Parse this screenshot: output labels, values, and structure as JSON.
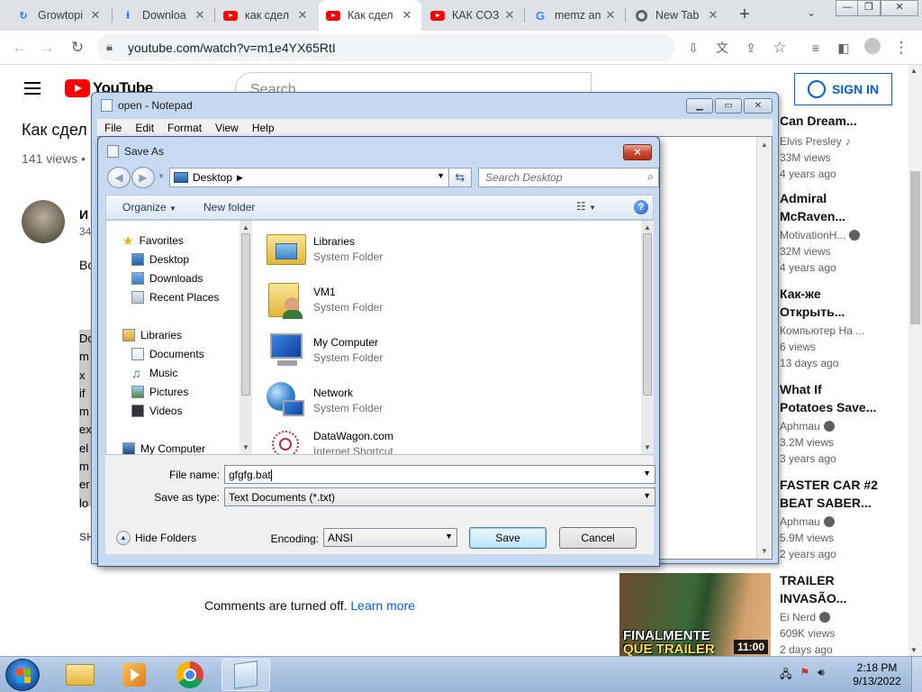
{
  "browser": {
    "tabs": [
      {
        "title": "Growtopi",
        "icon": "growtopia-favicon"
      },
      {
        "title": "Downloa",
        "icon": "download-favicon"
      },
      {
        "title": "как сдел",
        "icon": "youtube-favicon"
      },
      {
        "title": "Как сдел",
        "icon": "youtube-favicon",
        "active": true
      },
      {
        "title": "КАК СОЗ",
        "icon": "youtube-favicon"
      },
      {
        "title": "memz an",
        "icon": "google-favicon"
      },
      {
        "title": "New Tab",
        "icon": "chrome-favicon"
      }
    ],
    "close_glyph": "✕",
    "new_tab_glyph": "+",
    "tab_search_glyph": "⌄",
    "url": "youtube.com/watch?v=m1e4YX65RtI"
  },
  "youtube": {
    "logo_text": "YouTube",
    "search_placeholder": "Search",
    "sign_in_label": "SIGN IN",
    "video_title": "Как сдел",
    "views": "141 views •",
    "channel_initial": "И",
    "channel_sub": "34",
    "desc_lead": "Во",
    "desc_lines": [
      "Do",
      "m",
      "x",
      "if",
      "m",
      "ex",
      "el",
      "m",
      "er",
      "lo"
    ],
    "share_fragment": "SH",
    "comments_off": "Comments are turned off.",
    "learn_more": "Learn more",
    "recommendations": [
      {
        "title": "Can Dream...",
        "channel": "Elvis Presley",
        "badge": "♪",
        "views": "33M views",
        "age": "4 years ago"
      },
      {
        "title": "Admiral McRaven...",
        "title2": "McRaven...",
        "channel": "MotivationH...",
        "badge": "verified",
        "views": "32M views",
        "age": "4 years ago"
      },
      {
        "title": "Как-же",
        "title2": "Открыть...",
        "channel": "Компьютер На ...",
        "badge": "",
        "views": "6 views",
        "age": "13 days ago"
      },
      {
        "title": "What If",
        "title2": "Potatoes Save...",
        "channel": "Aphmau",
        "badge": "verified",
        "views": "3.2M views",
        "age": "3 years ago"
      },
      {
        "title": "FASTER CAR #2",
        "title2": "BEAT SABER...",
        "channel": "Aphmau",
        "badge": "verified",
        "views": "5.9M views",
        "age": "2 years ago"
      },
      {
        "title": "TRAILER",
        "title2": "INVASÃO...",
        "channel": "Ei Nerd",
        "badge": "verified",
        "views": "609K views",
        "age": "2 days ago"
      }
    ],
    "thumb_line1": "FINALMENTE",
    "thumb_line2": "QUE TRAILER",
    "thumb_duration": "11:00"
  },
  "notepad": {
    "title": "open - Notepad",
    "menu": [
      "File",
      "Edit",
      "Format",
      "View",
      "Help"
    ]
  },
  "save_as": {
    "title": "Save As",
    "address": "Desktop",
    "search_placeholder": "Search Desktop",
    "organize": "Organize",
    "new_folder": "New folder",
    "nav": {
      "favorites": "Favorites",
      "desktop": "Desktop",
      "downloads": "Downloads",
      "recent_places": "Recent Places",
      "libraries": "Libraries",
      "documents": "Documents",
      "music": "Music",
      "pictures": "Pictures",
      "videos": "Videos",
      "my_computer": "My Computer"
    },
    "files": [
      {
        "name": "Libraries",
        "type": "System Folder",
        "icon": "libraries-folder-icon"
      },
      {
        "name": "VM1",
        "type": "System Folder",
        "icon": "user-folder-icon"
      },
      {
        "name": "My Computer",
        "type": "System Folder",
        "icon": "computer-icon"
      },
      {
        "name": "Network",
        "type": "System Folder",
        "icon": "network-icon"
      },
      {
        "name": "DataWagon.com",
        "type": "Internet Shortcut",
        "icon": "internet-shortcut-icon"
      }
    ],
    "file_name_label": "File name:",
    "file_name_value": "gfgfg.bat",
    "save_type_label": "Save as type:",
    "save_type_value": "Text Documents (*.txt)",
    "encoding_label": "Encoding:",
    "encoding_value": "ANSI",
    "save_button": "Save",
    "cancel_button": "Cancel",
    "hide_folders": "Hide Folders"
  },
  "taskbar": {
    "time": "2:18 PM",
    "date": "9/13/2022"
  },
  "colors": {
    "youtube_red": "#ff0000",
    "link_blue": "#065fd4",
    "close_red": "#c7452d"
  }
}
